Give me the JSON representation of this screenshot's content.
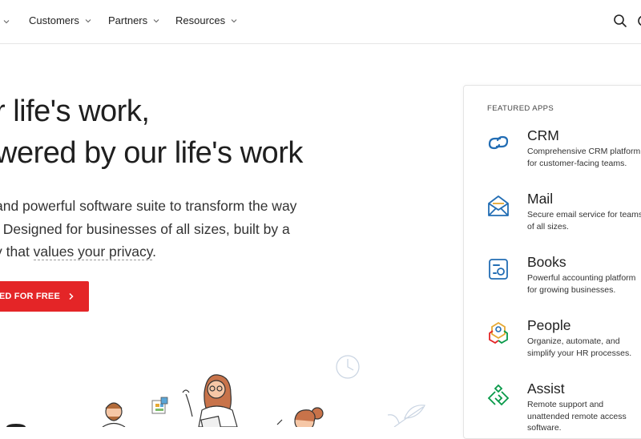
{
  "nav": {
    "items": [
      {
        "label": "Customers"
      },
      {
        "label": "Partners"
      },
      {
        "label": "Resources"
      }
    ]
  },
  "hero": {
    "title_line1": "r life's work,",
    "title_line2": "wered by our life's work",
    "sub_line1": "and powerful software suite to transform the way",
    "sub_line2": ". Designed for businesses of all sizes, built by a",
    "sub_line3_pre": "y that ",
    "sub_line3_link": "values your privacy",
    "sub_line3_post": ".",
    "cta_label": "TED FOR FREE"
  },
  "featured": {
    "heading": "FEATURED APPS",
    "apps": [
      {
        "name": "CRM",
        "desc1": "Comprehensive CRM platform",
        "desc2": "for customer-facing teams.",
        "icon": "crm-icon",
        "color": "#226db4"
      },
      {
        "name": "Mail",
        "desc1": "Secure email service for teams",
        "desc2": "of all sizes.",
        "icon": "mail-icon",
        "color": "#226db4"
      },
      {
        "name": "Books",
        "desc1": "Powerful accounting platform",
        "desc2": "for growing businesses.",
        "icon": "books-icon",
        "color": "#226db4"
      },
      {
        "name": "People",
        "desc1": "Organize, automate, and",
        "desc2": "simplify your HR processes.",
        "icon": "people-icon",
        "color": "#e42527"
      },
      {
        "name": "Assist",
        "desc1": "Remote support and",
        "desc2": "unattended remote access",
        "desc3": "software.",
        "icon": "assist-icon",
        "color": "#089949"
      }
    ]
  },
  "colors": {
    "accent": "#e42527",
    "brand_blue": "#226db4"
  }
}
